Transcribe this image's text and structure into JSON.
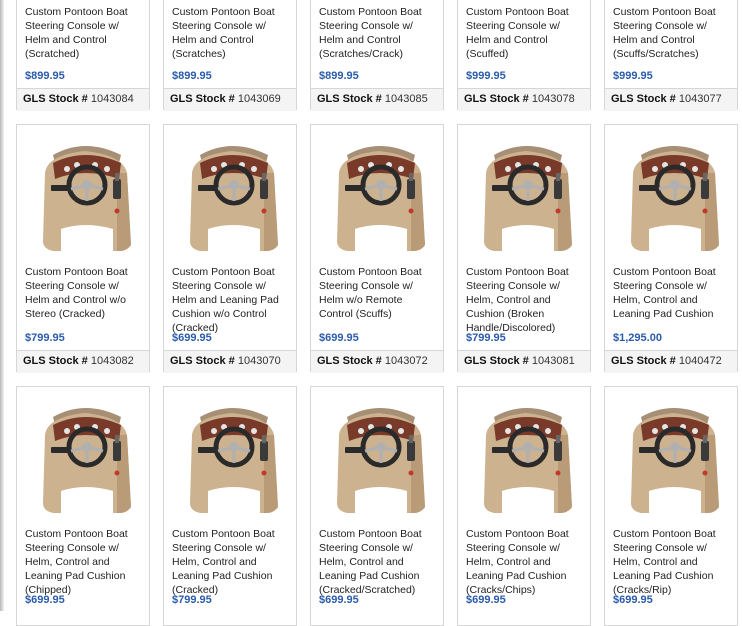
{
  "listings": [
    {
      "title": "Custom Pontoon Boat Steering Console w/ Helm and Control (Scratched)",
      "price": "$899.95",
      "stock_label": "GLS Stock #",
      "stock_number": "1043084"
    },
    {
      "title": "Custom Pontoon Boat Steering Console w/ Helm and Control (Scratches)",
      "price": "$899.95",
      "stock_label": "GLS Stock #",
      "stock_number": "1043069"
    },
    {
      "title": "Custom Pontoon Boat Steering Console w/ Helm and Control (Scratches/Crack)",
      "price": "$899.95",
      "stock_label": "GLS Stock #",
      "stock_number": "1043085"
    },
    {
      "title": "Custom Pontoon Boat Steering Console w/ Helm and Control (Scuffed)",
      "price": "$999.95",
      "stock_label": "GLS Stock #",
      "stock_number": "1043078"
    },
    {
      "title": "Custom Pontoon Boat Steering Console w/ Helm and Control (Scuffs/Scratches)",
      "price": "$999.95",
      "stock_label": "GLS Stock #",
      "stock_number": "1043077"
    },
    {
      "title": "Custom Pontoon Boat Steering Console w/ Helm and Control w/o Stereo (Cracked)",
      "price": "$799.95",
      "stock_label": "GLS Stock #",
      "stock_number": "1043082"
    },
    {
      "title": "Custom Pontoon Boat Steering Console w/ Helm and Leaning Pad Cushion w/o Control (Cracked)",
      "price": "$699.95",
      "stock_label": "GLS Stock #",
      "stock_number": "1043070"
    },
    {
      "title": "Custom Pontoon Boat Steering Console w/ Helm w/o Remote Control (Scuffs)",
      "price": "$699.95",
      "stock_label": "GLS Stock #",
      "stock_number": "1043072"
    },
    {
      "title": "Custom Pontoon Boat Steering Console w/ Helm, Control and Cushion (Broken Handle/Discolored)",
      "price": "$799.95",
      "stock_label": "GLS Stock #",
      "stock_number": "1043081"
    },
    {
      "title": "Custom Pontoon Boat Steering Console w/ Helm, Control and Leaning Pad Cushion",
      "price": "$1,295.00",
      "stock_label": "GLS Stock #",
      "stock_number": "1040472"
    },
    {
      "title": "Custom Pontoon Boat Steering Console w/ Helm, Control and Leaning Pad Cushion (Chipped)",
      "price": "$699.95"
    },
    {
      "title": "Custom Pontoon Boat Steering Console w/ Helm, Control and Leaning Pad Cushion (Cracked)",
      "price": "$799.95"
    },
    {
      "title": "Custom Pontoon Boat Steering Console w/ Helm, Control and Leaning Pad Cushion (Cracked/Scratched)",
      "price": "$699.95"
    },
    {
      "title": "Custom Pontoon Boat Steering Console w/ Helm, Control and Leaning Pad Cushion (Cracks/Chips)",
      "price": "$699.95"
    },
    {
      "title": "Custom Pontoon Boat Steering Console w/ Helm, Control and Leaning Pad Cushion (Cracks/Rip)",
      "price": "$699.95"
    }
  ],
  "colors": {
    "price": "#2b5cab",
    "console_body": "#cdb28f",
    "dash_panel": "#7a3a2a",
    "wheel": "#2a2a2a"
  }
}
